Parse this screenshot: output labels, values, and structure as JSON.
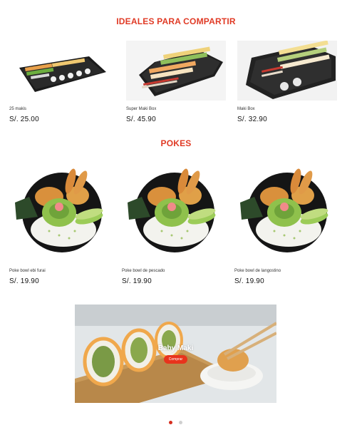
{
  "sections": {
    "sharing_title": "IDEALES PARA COMPARTIR",
    "pokes_title": "POKES"
  },
  "sharing_products": [
    {
      "name": "25 makis",
      "price": "S/. 25.00",
      "image": "makis-tray-image"
    },
    {
      "name": "Super Maki Box",
      "price": "S/. 45.90",
      "image": "super-maki-box-image"
    },
    {
      "name": "Maki Box",
      "price": "S/. 32.90",
      "image": "maki-box-image"
    }
  ],
  "poke_products": [
    {
      "name": "Poke bowl ebi furai",
      "price": "S/. 19.90",
      "image": "poke-bowl-image"
    },
    {
      "name": "Poke bowl de pescado",
      "price": "S/. 19.90",
      "image": "poke-bowl-image"
    },
    {
      "name": "Poke bowl de langostino",
      "price": "S/. 19.90",
      "image": "poke-bowl-image"
    }
  ],
  "banner": {
    "title": "Baby Maki",
    "button_label": "Comprar"
  },
  "carousel": {
    "slides": 2,
    "active_slide": 1
  },
  "colors": {
    "accent": "#e03a25",
    "button": "#e8331c",
    "dot_active": "#d62e1f",
    "dot_inactive": "#cfcfcf"
  }
}
